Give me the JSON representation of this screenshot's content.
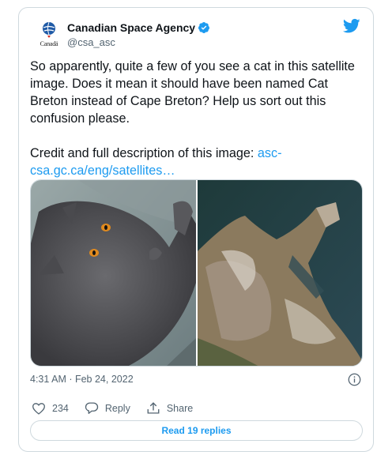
{
  "author": {
    "display_name": "Canadian Space Agency",
    "handle": "@csa_asc",
    "avatar_wordmark": "Canadä",
    "verified": true
  },
  "tweet": {
    "text_main": "So apparently, quite a few of you see a cat in this satellite image. Does it mean it should have been named Cat Breton instead of Cape Breton? Help us sort out this confusion please.\n\nCredit and full description of this image: ",
    "link_text": "asc-csa.gc.ca/eng/satellites…",
    "timestamp": "4:31 AM · Feb 24, 2022"
  },
  "media": [
    {
      "name": "cat-photo"
    },
    {
      "name": "satellite-image"
    }
  ],
  "actions": {
    "likes": "234",
    "reply_label": "Reply",
    "share_label": "Share"
  },
  "read_replies_label": "Read 19 replies",
  "colors": {
    "link_blue": "#1d9bf0",
    "secondary_text": "#536471",
    "border": "#cfd9de"
  },
  "icons": [
    "globe-icon",
    "verified-badge-icon",
    "twitter-bird-icon",
    "info-icon",
    "heart-icon",
    "reply-icon",
    "share-icon"
  ]
}
